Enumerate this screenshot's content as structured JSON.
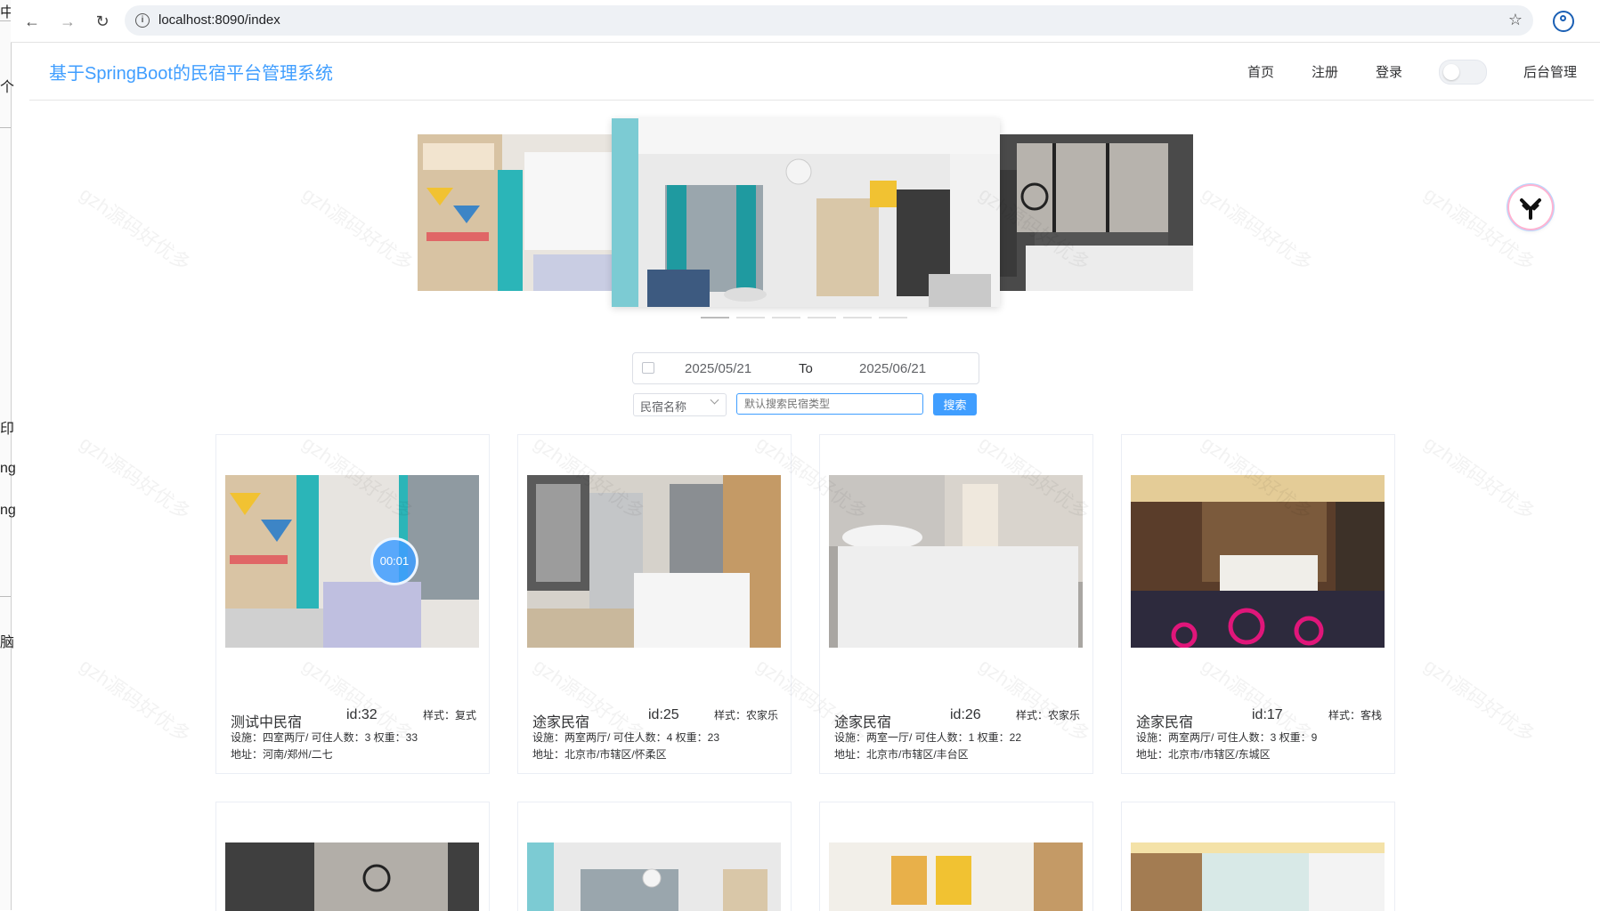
{
  "left_edge_glyphs": [
    "中",
    "个",
    "印",
    "ng",
    "ng",
    "脑"
  ],
  "browser": {
    "url": "localhost:8090/index",
    "icons": [
      "back-icon",
      "forward-icon",
      "reload-icon",
      "site-info-icon",
      "bookmark-star-icon",
      "profile-icon"
    ]
  },
  "header": {
    "brand": "基于SpringBoot的民宿平台管理系统",
    "nav": [
      "首页",
      "注册",
      "登录"
    ],
    "admin_link": "后台管理"
  },
  "carousel": {
    "slide_count": 6,
    "active_index": 0
  },
  "search": {
    "start_date": "2025/05/21",
    "separator": "To",
    "end_date": "2025/06/21",
    "field_select": "民宿名称",
    "placeholder": "默认搜索民宿类型",
    "button": "搜索"
  },
  "cards": [
    {
      "name": "测试中民宿",
      "id": "id:32",
      "style": "样式：复式",
      "facility": "设施：四室两厅/ 可住人数：3 权重：33",
      "address": "地址：河南/郑州/二七",
      "timer": "00:01"
    },
    {
      "name": "途家民宿",
      "id": "id:25",
      "style": "样式：农家乐",
      "facility": "设施：两室两厅/ 可住人数：4 权重：23",
      "address": "地址：北京市/市辖区/怀柔区"
    },
    {
      "name": "途家民宿",
      "id": "id:26",
      "style": "样式：农家乐",
      "facility": "设施：两室一厅/ 可住人数：1 权重：22",
      "address": "地址：北京市/市辖区/丰台区"
    },
    {
      "name": "途家民宿",
      "id": "id:17",
      "style": "样式：客栈",
      "facility": "设施：两室两厅/ 可住人数：3 权重：9",
      "address": "地址：北京市/市辖区/东城区"
    }
  ],
  "watermark": "gzh源码好优多",
  "colors": {
    "accent": "#409eff",
    "text": "#303133",
    "border": "#ebeef5"
  }
}
